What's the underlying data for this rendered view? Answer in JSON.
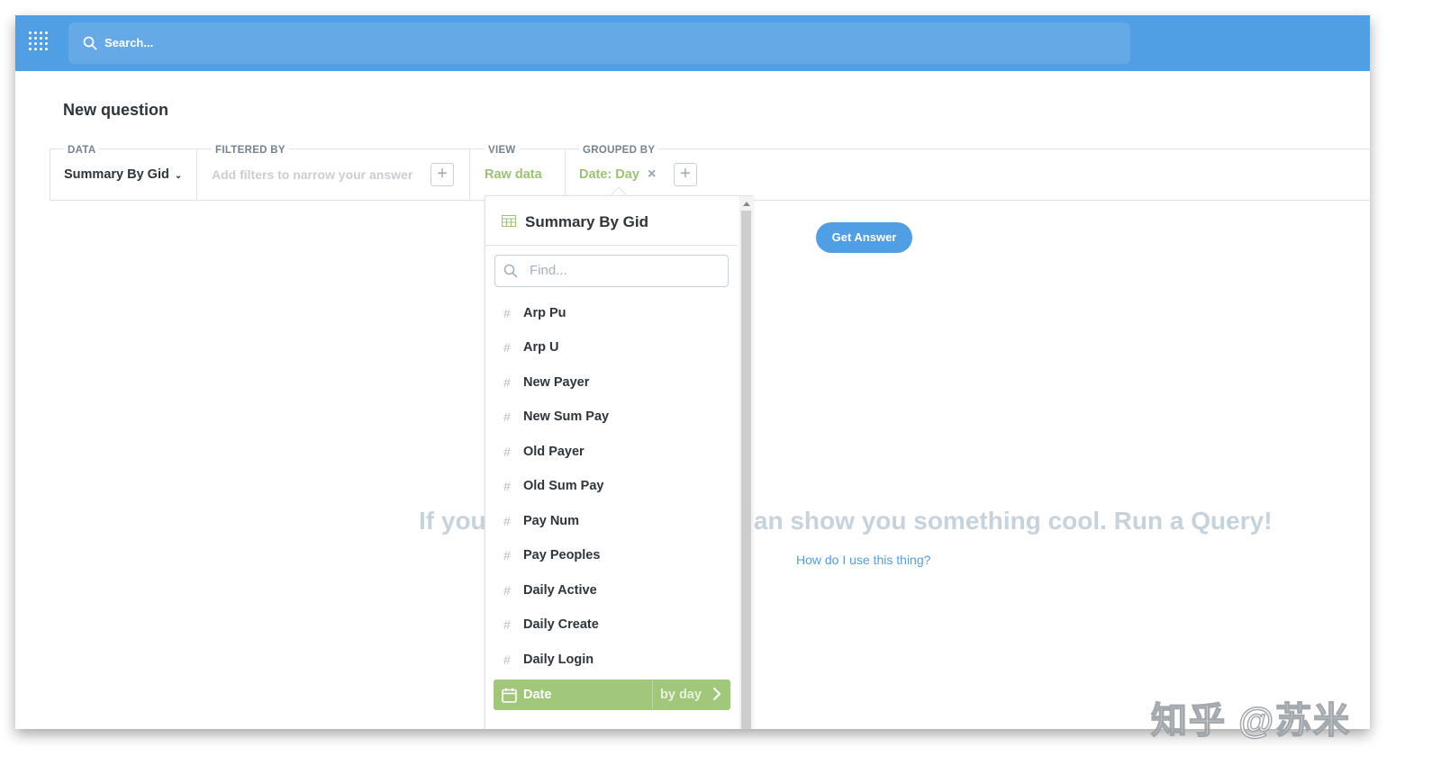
{
  "header": {
    "search_placeholder": "Search..."
  },
  "page": {
    "title": "New question"
  },
  "query_bar": {
    "data_label": "DATA",
    "data_value": "Summary By Gid",
    "filter_label": "FILTERED BY",
    "filter_placeholder": "Add filters to narrow your answer",
    "view_label": "VIEW",
    "view_value": "Raw data",
    "grouped_label": "GROUPED BY",
    "grouped_value": "Date: Day",
    "remove_symbol": "×",
    "add_symbol": "+"
  },
  "actions": {
    "get_answer": "Get Answer"
  },
  "empty_state": {
    "message": "If you give me some data I can show you something cool. Run a Query!",
    "help_link": "How do I use this thing?"
  },
  "field_picker": {
    "table_name": "Summary By Gid",
    "find_placeholder": "Find...",
    "hash_symbol": "#",
    "fields": [
      {
        "name": "Arp Pu"
      },
      {
        "name": "Arp U"
      },
      {
        "name": "New Payer"
      },
      {
        "name": "New Sum Pay"
      },
      {
        "name": "Old Payer"
      },
      {
        "name": "Old Sum Pay"
      },
      {
        "name": "Pay Num"
      },
      {
        "name": "Pay Peoples"
      },
      {
        "name": "Daily Active"
      },
      {
        "name": "Daily Create"
      },
      {
        "name": "Daily Login"
      }
    ],
    "selected_field": {
      "name": "Date",
      "bucket": "by day"
    }
  },
  "watermark": "知乎 @苏米",
  "colors": {
    "brand": "#509ee3",
    "breakout_green": "#a0c77a",
    "filter_purple_placeholder": "#c9ced3",
    "text_dark": "#2e353b"
  }
}
